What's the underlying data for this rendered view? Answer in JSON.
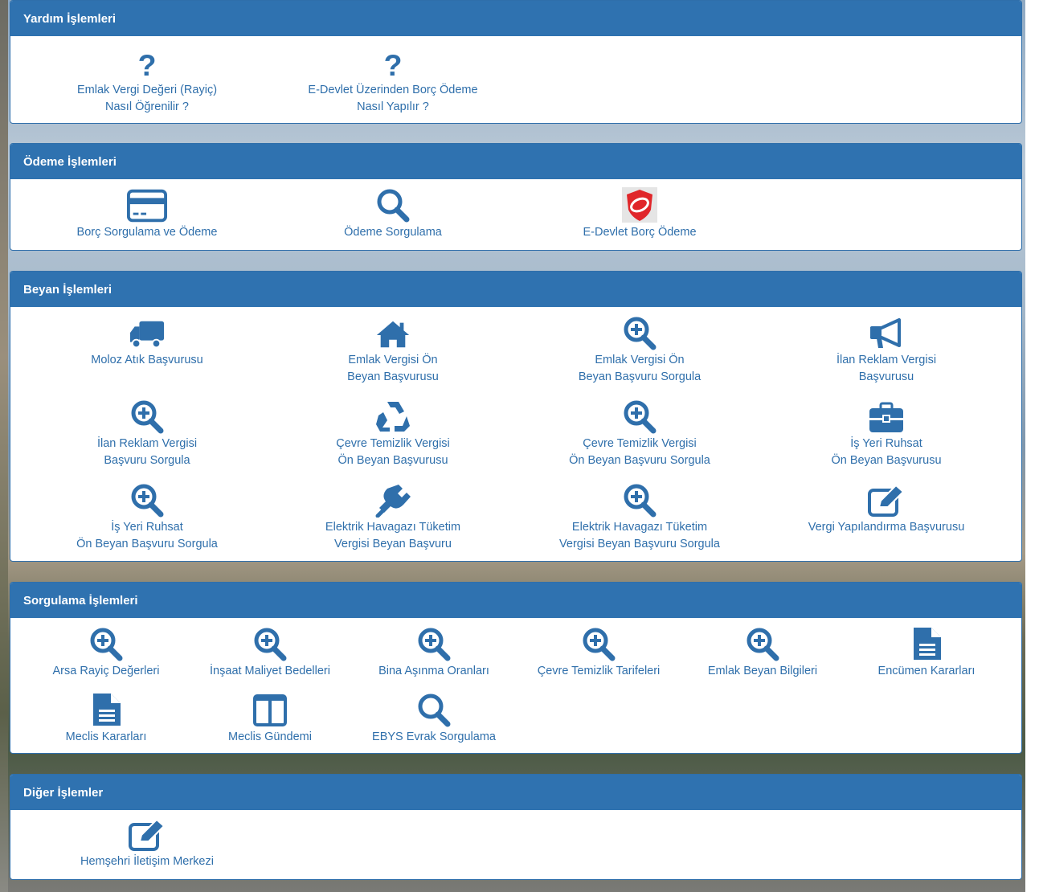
{
  "colors": {
    "primary": "#2f72b0",
    "link": "#2f6fab",
    "background": "#ffffff"
  },
  "sections": [
    {
      "title": "Yardım İşlemleri",
      "items": [
        {
          "icon": "question-icon",
          "label": "Emlak Vergi Değeri (Rayiç)\nNasıl Öğrenilir ?"
        },
        {
          "icon": "question-icon",
          "label": "E-Devlet Üzerinden Borç Ödeme\nNasıl Yapılır ?"
        }
      ]
    },
    {
      "title": "Ödeme İşlemleri",
      "items": [
        {
          "icon": "credit-card-icon",
          "label": "Borç Sorgulama ve Ödeme"
        },
        {
          "icon": "search-icon",
          "label": "Ödeme Sorgulama"
        },
        {
          "icon": "edevlet-logo-icon",
          "label": "E-Devlet Borç Ödeme"
        }
      ]
    },
    {
      "title": "Beyan İşlemleri",
      "items": [
        {
          "icon": "truck-icon",
          "label": "Moloz Atık Başvurusu"
        },
        {
          "icon": "home-icon",
          "label": "Emlak Vergisi Ön\nBeyan Başvurusu"
        },
        {
          "icon": "zoom-in-icon",
          "label": "Emlak Vergisi Ön\nBeyan Başvuru Sorgula"
        },
        {
          "icon": "megaphone-icon",
          "label": "İlan Reklam Vergisi\nBaşvurusu"
        },
        {
          "icon": "zoom-in-icon",
          "label": "İlan Reklam Vergisi\nBaşvuru Sorgula"
        },
        {
          "icon": "recycle-icon",
          "label": "Çevre Temizlik Vergisi\nÖn Beyan Başvurusu"
        },
        {
          "icon": "zoom-in-icon",
          "label": "Çevre Temizlik Vergisi\nÖn Beyan Başvuru Sorgula"
        },
        {
          "icon": "briefcase-icon",
          "label": "İş Yeri Ruhsat\nÖn Beyan Başvurusu"
        },
        {
          "icon": "zoom-in-icon",
          "label": "İş Yeri Ruhsat\nÖn Beyan Başvuru Sorgula"
        },
        {
          "icon": "plug-icon",
          "label": "Elektrik Havagazı Tüketim\nVergisi Beyan Başvuru"
        },
        {
          "icon": "zoom-in-icon",
          "label": "Elektrik Havagazı Tüketim\nVergisi Beyan Başvuru Sorgula"
        },
        {
          "icon": "edit-icon",
          "label": "Vergi Yapılandırma Başvurusu"
        }
      ]
    },
    {
      "title": "Sorgulama İşlemleri",
      "items": [
        {
          "icon": "zoom-in-icon",
          "label": "Arsa Rayiç Değerleri"
        },
        {
          "icon": "zoom-in-icon",
          "label": "İnşaat Maliyet Bedelleri"
        },
        {
          "icon": "zoom-in-icon",
          "label": "Bina Aşınma Oranları"
        },
        {
          "icon": "zoom-in-icon",
          "label": "Çevre Temizlik Tarifeleri"
        },
        {
          "icon": "zoom-in-icon",
          "label": "Emlak Beyan Bilgileri"
        },
        {
          "icon": "document-icon",
          "label": "Encümen Kararları"
        },
        {
          "icon": "document-icon",
          "label": "Meclis Kararları"
        },
        {
          "icon": "columns-icon",
          "label": "Meclis Gündemi"
        },
        {
          "icon": "search-icon",
          "label": "EBYS Evrak Sorgulama"
        }
      ]
    },
    {
      "title": "Diğer İşlemler",
      "items": [
        {
          "icon": "edit-icon",
          "label": "Hemşehri İletişim Merkezi"
        }
      ]
    }
  ]
}
